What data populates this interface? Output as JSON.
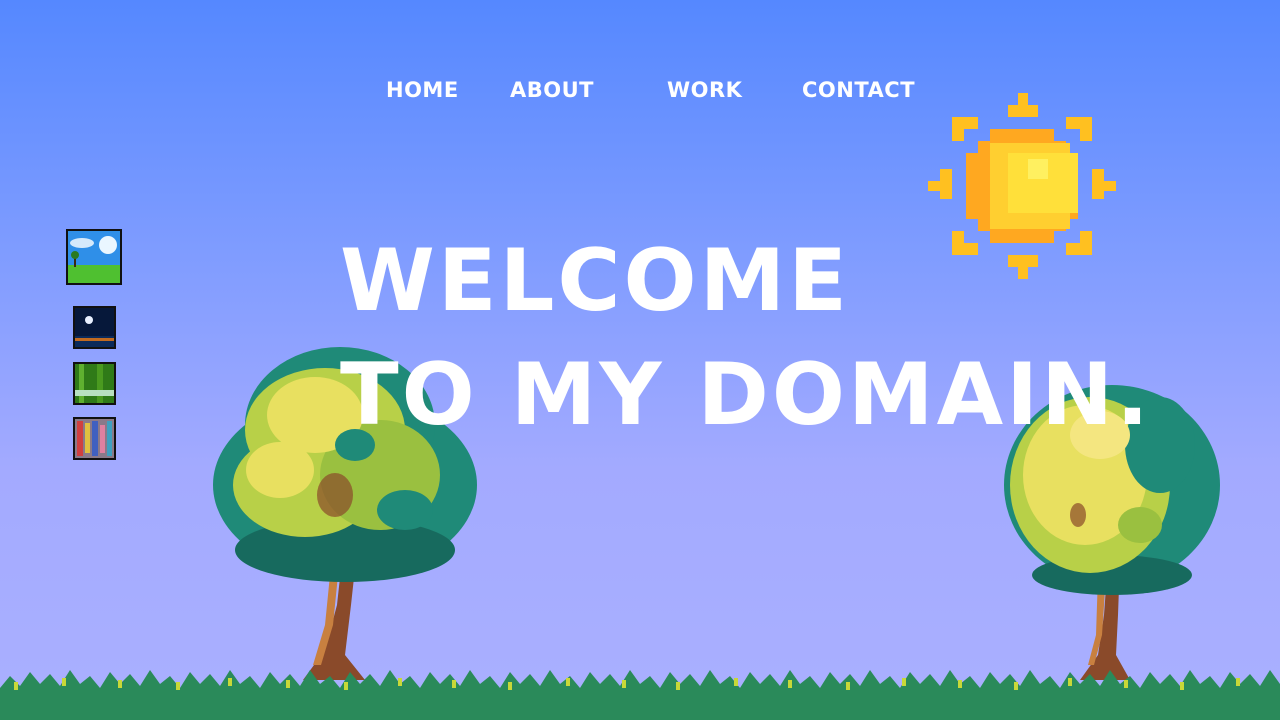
{
  "nav": {
    "items": [
      {
        "label": "HOME"
      },
      {
        "label": "ABOUT"
      },
      {
        "label": "WORK"
      },
      {
        "label": "CONTACT"
      }
    ]
  },
  "hero": {
    "line1": "WELCOME",
    "line2": "TO MY DOMAIN."
  },
  "thumbnails": [
    {
      "name": "meadow-sky"
    },
    {
      "name": "night-moon"
    },
    {
      "name": "forest-stream"
    },
    {
      "name": "city-street"
    }
  ],
  "colors": {
    "sky_top": "#5588ff",
    "sky_bottom": "#aab0ff",
    "sun": "#ffc020",
    "foliage_dark": "#1f8a78",
    "foliage_light": "#e8e060",
    "trunk": "#8a4a2a",
    "grass": "#2a8a5a"
  }
}
